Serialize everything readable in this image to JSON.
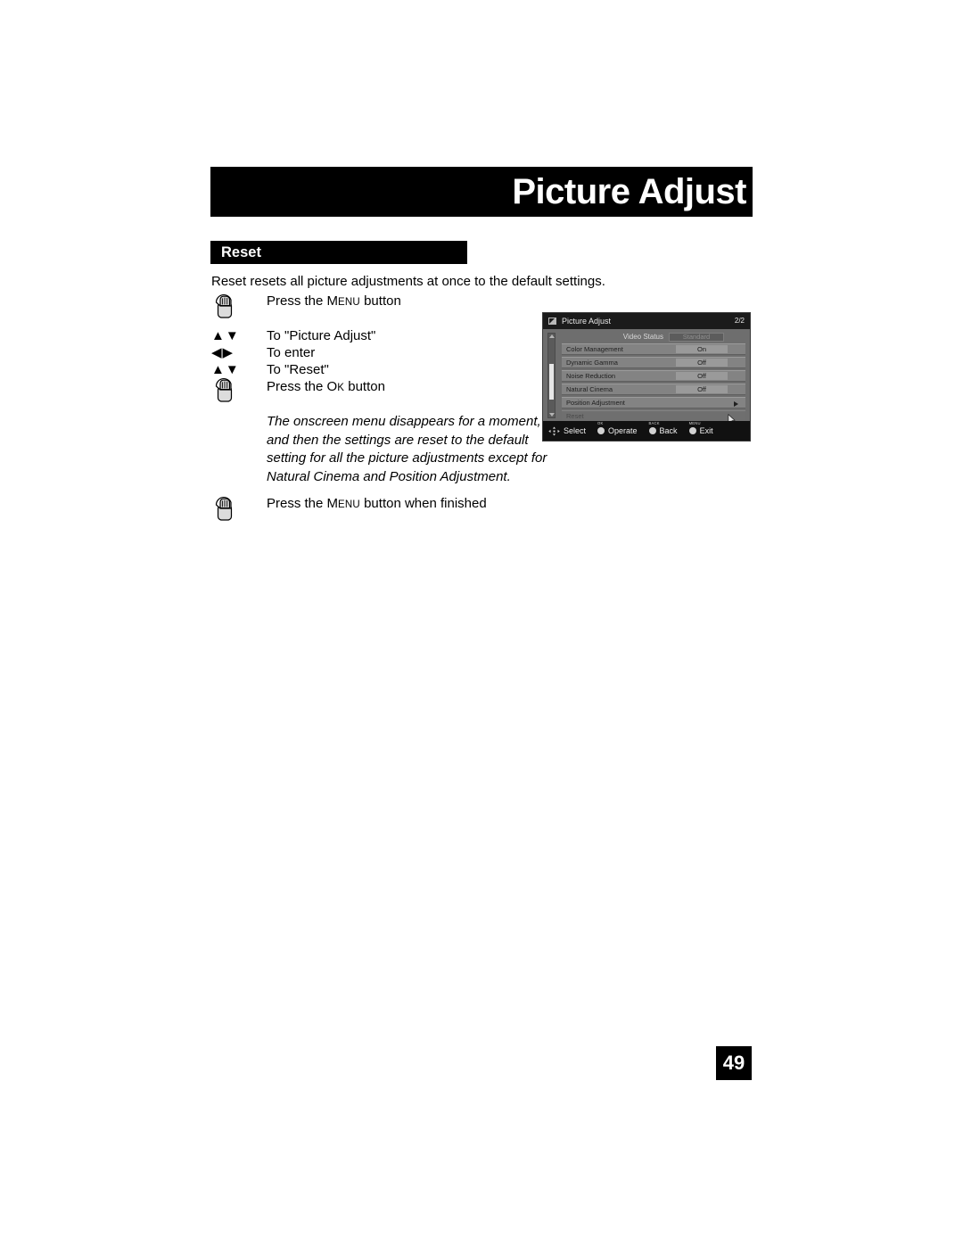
{
  "page": {
    "title": "Picture Adjust",
    "section_heading": "Reset",
    "intro": "Reset resets all picture adjustments at once to the default settings.",
    "page_number": "49"
  },
  "steps": [
    {
      "icon": "hand-press-button-icon",
      "text_lead": "Press the ",
      "key_cap": "M",
      "key_rest": "ENU",
      "text_tail": " button"
    },
    {
      "icon": "up-down-arrows-icon",
      "glyph": "▲▼",
      "text": "To \"Picture Adjust\""
    },
    {
      "icon": "left-right-arrows-icon",
      "glyph": "◀▶",
      "text": "To enter"
    },
    {
      "icon": "up-down-arrows-icon",
      "glyph": "▲▼",
      "text": "To \"Reset\""
    },
    {
      "icon": "hand-press-button-icon",
      "text_lead": "Press the ",
      "key_cap": "O",
      "key_rest": "K",
      "text_tail": " button"
    }
  ],
  "note_lines": [
    "The onscreen menu disappears for a moment,",
    "and then the settings are reset to the default",
    "setting for all the picture adjustments except for",
    "Natural Cinema and Position Adjustment."
  ],
  "final_step": {
    "icon": "hand-press-button-icon",
    "text_lead": "Press the ",
    "key_cap": "M",
    "key_rest": "ENU",
    "text_tail": " button when finished"
  },
  "osd": {
    "title": "Picture Adjust",
    "page_indicator": "2/2",
    "status": {
      "label": "Video Status",
      "value": "Standard"
    },
    "rows": [
      {
        "label": "Color Management",
        "value": "On",
        "type": "value",
        "state": "normal"
      },
      {
        "label": "Dynamic Gamma",
        "value": "Off",
        "type": "value",
        "state": "normal"
      },
      {
        "label": "Noise Reduction",
        "value": "Off",
        "type": "value",
        "state": "normal"
      },
      {
        "label": "Natural Cinema",
        "value": "Off",
        "type": "value",
        "state": "normal"
      },
      {
        "label": "Position Adjustment",
        "value": "",
        "type": "submenu",
        "state": "normal"
      },
      {
        "label": "Reset",
        "value": "",
        "type": "action",
        "state": "dim"
      }
    ],
    "bottom_bar": [
      {
        "cap": "",
        "label": "Select",
        "icon": "dpad-icon"
      },
      {
        "cap": "OK",
        "label": "Operate",
        "icon": "round-button-icon"
      },
      {
        "cap": "BACK",
        "label": "Back",
        "icon": "round-button-icon"
      },
      {
        "cap": "MENU",
        "label": "Exit",
        "icon": "round-button-icon"
      }
    ]
  },
  "colors": {
    "banner_bg": "#000000",
    "banner_text": "#ffffff",
    "osd_bg": "#6e6e6e",
    "osd_row": "#838383",
    "osd_titlebar": "#1b1b1b"
  }
}
